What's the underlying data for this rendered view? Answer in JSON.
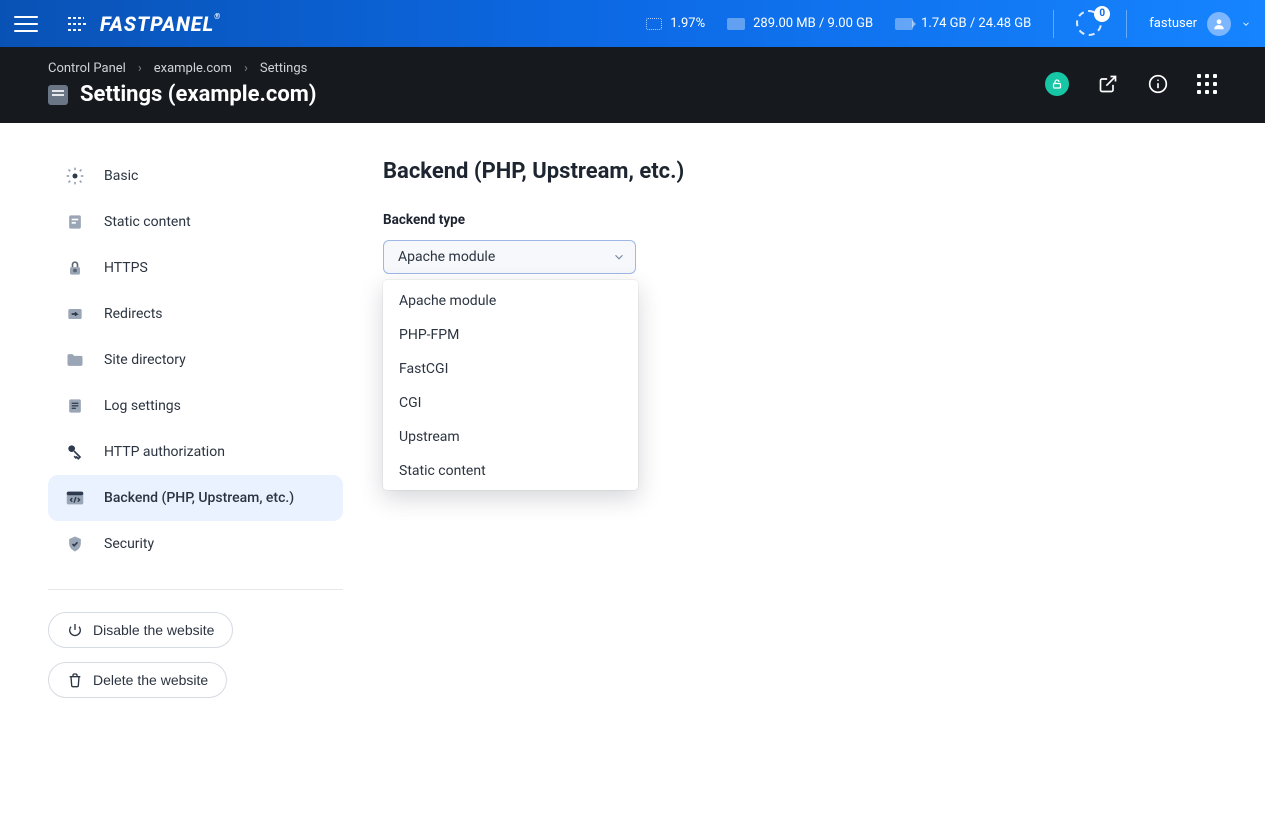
{
  "topbar": {
    "cpu": "1.97%",
    "mem": "289.00 MB / 9.00 GB",
    "disk": "1.74 GB / 24.48 GB",
    "spinner_badge": "0",
    "username": "fastuser"
  },
  "breadcrumbs": {
    "0": "Control Panel",
    "1": "example.com",
    "2": "Settings"
  },
  "page_title": "Settings (example.com)",
  "sidebar": {
    "items": {
      "0": {
        "label": "Basic"
      },
      "1": {
        "label": "Static content"
      },
      "2": {
        "label": "HTTPS"
      },
      "3": {
        "label": "Redirects"
      },
      "4": {
        "label": "Site directory"
      },
      "5": {
        "label": "Log settings"
      },
      "6": {
        "label": "HTTP authorization"
      },
      "7": {
        "label": "Backend (PHP, Upstream, etc.)"
      },
      "8": {
        "label": "Security"
      }
    },
    "disable_label": "Disable the website",
    "delete_label": "Delete the website"
  },
  "main": {
    "heading": "Backend (PHP, Upstream, etc.)",
    "backend_type_label": "Backend type",
    "backend_type_value": "Apache module"
  },
  "dropdown": {
    "0": "Apache module",
    "1": "PHP-FPM",
    "2": "FastCGI",
    "3": "CGI",
    "4": "Upstream",
    "5": "Static content"
  }
}
